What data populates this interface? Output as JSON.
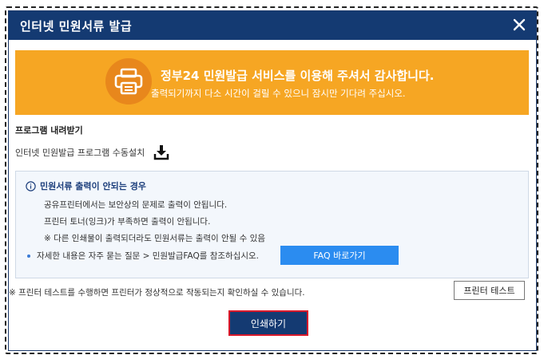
{
  "dialog": {
    "title": "인터넷 민원서류 발급",
    "close_icon": "close-icon"
  },
  "banner": {
    "icon": "printer-icon",
    "main_text": "정부24 민원발급 서비스를 이용해 주셔서 감사합니다.",
    "sub_text": "출력되기까지 다소 시간이 걸릴 수 있으니 잠시만 기다려 주십시오.",
    "background": "#f6a623"
  },
  "download": {
    "heading": "프로그램 내려받기",
    "label": "인터넷 민원발급 프로그램 수동설치",
    "icon": "download-icon"
  },
  "info": {
    "title": "민원서류 출력이 안되는 경우",
    "icon": "info-icon",
    "lines": [
      "공유프린터에서는 보안상의 문제로 출력이 안됩니다.",
      "프린터 토너(잉크)가 부족하면 출력이 안됩니다.",
      "※ 다른 인쇄물이 출력되더라도 민원서류는 출력이 안될 수 있음"
    ],
    "faq_text": "자세한 내용은 자주 묻는 질문 > 민원발급FAQ를 참조하십시오.",
    "faq_button": "FAQ 바로가기"
  },
  "test": {
    "note": "※ 프린터 테스트를 수행하면 프린터가 정상적으로 작동되는지 확인하실 수 있습니다.",
    "button": "프린터 테스트"
  },
  "actions": {
    "print_button": "인쇄하기"
  },
  "colors": {
    "title_bar": "#143a72",
    "accent": "#2b8cf0",
    "print_border": "#d9182a"
  }
}
